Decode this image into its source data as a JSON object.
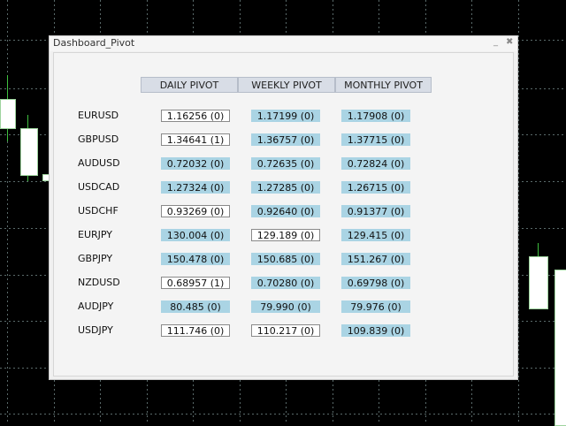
{
  "window": {
    "title": "Dashboard_Pivot",
    "min_label": "_",
    "close_label": "✖"
  },
  "columns": [
    "DAILY PIVOT",
    "WEEKLY PIVOT",
    "MONTHLY PIVOT"
  ],
  "rows": [
    {
      "symbol": "EURUSD",
      "daily": "1.16256 (0)",
      "weekly": "1.17199 (0)",
      "monthly": "1.17908 (0)",
      "styles": [
        "white",
        "blue",
        "blue"
      ]
    },
    {
      "symbol": "GBPUSD",
      "daily": "1.34641 (1)",
      "weekly": "1.36757 (0)",
      "monthly": "1.37715 (0)",
      "styles": [
        "white",
        "blue",
        "blue"
      ]
    },
    {
      "symbol": "AUDUSD",
      "daily": "0.72032 (0)",
      "weekly": "0.72635 (0)",
      "monthly": "0.72824 (0)",
      "styles": [
        "blue",
        "blue",
        "blue"
      ]
    },
    {
      "symbol": "USDCAD",
      "daily": "1.27324 (0)",
      "weekly": "1.27285 (0)",
      "monthly": "1.26715 (0)",
      "styles": [
        "blue",
        "blue",
        "blue"
      ]
    },
    {
      "symbol": "USDCHF",
      "daily": "0.93269 (0)",
      "weekly": "0.92640 (0)",
      "monthly": "0.91377 (0)",
      "styles": [
        "white",
        "blue",
        "blue"
      ]
    },
    {
      "symbol": "EURJPY",
      "daily": "130.004 (0)",
      "weekly": "129.189 (0)",
      "monthly": "129.415 (0)",
      "styles": [
        "blue",
        "white",
        "blue"
      ]
    },
    {
      "symbol": "GBPJPY",
      "daily": "150.478 (0)",
      "weekly": "150.685 (0)",
      "monthly": "151.267 (0)",
      "styles": [
        "blue",
        "blue",
        "blue"
      ]
    },
    {
      "symbol": "NZDUSD",
      "daily": "0.68957 (1)",
      "weekly": "0.70280 (0)",
      "monthly": "0.69798 (0)",
      "styles": [
        "white",
        "blue",
        "blue"
      ]
    },
    {
      "symbol": "AUDJPY",
      "daily": "80.485 (0)",
      "weekly": "79.990 (0)",
      "monthly": "79.976 (0)",
      "styles": [
        "blue",
        "blue",
        "blue"
      ]
    },
    {
      "symbol": "USDJPY",
      "daily": "111.746 (0)",
      "weekly": "110.217 (0)",
      "monthly": "109.839 (0)",
      "styles": [
        "white",
        "white",
        "blue"
      ]
    }
  ],
  "colors": {
    "background": "#000000",
    "grid": "#5a6a6a",
    "blue_cell": "#aad4e4",
    "white_cell": "#ffffff",
    "header": "#d8dde6"
  }
}
